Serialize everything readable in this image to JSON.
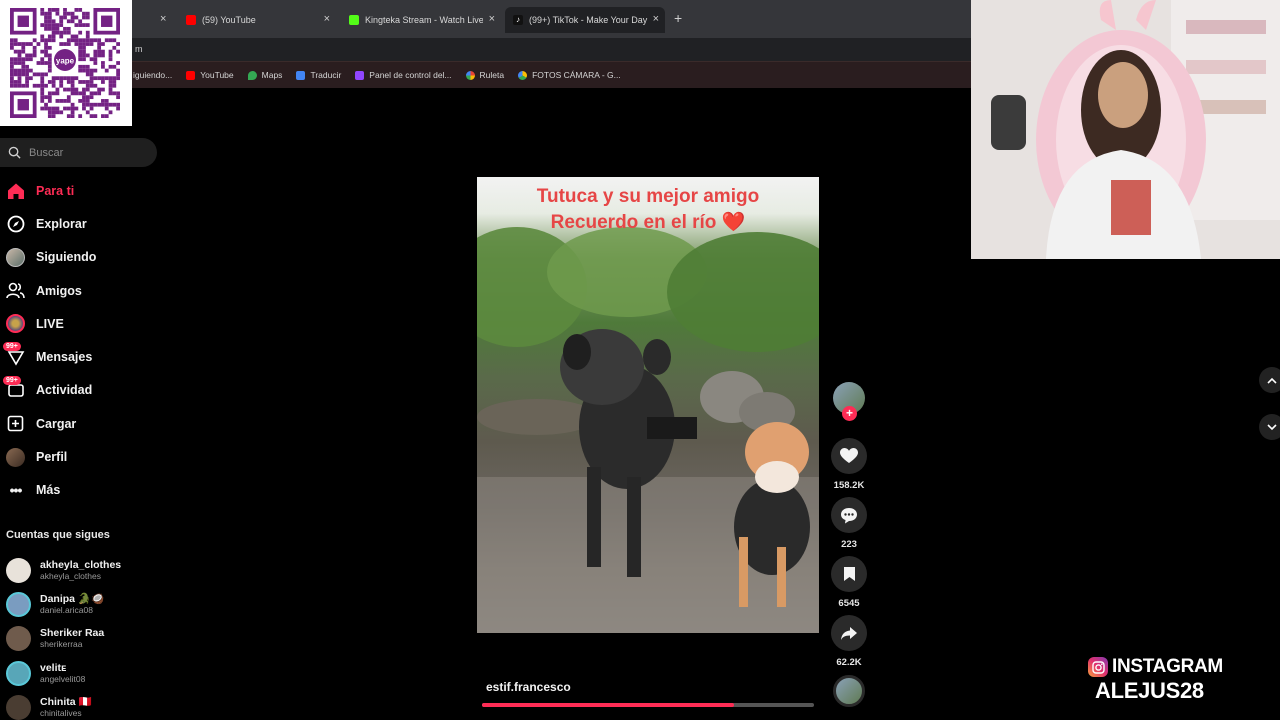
{
  "browser": {
    "tabs": [
      {
        "label": "(59) YouTube",
        "favicon_color": "#ff0000"
      },
      {
        "label": "Kingteka Stream - Watch Live o",
        "favicon_color": "#53fc18"
      },
      {
        "label": "(99+) TikTok - Make Your Day",
        "favicon_color": "#ffffff"
      }
    ],
    "close_glyph": "×",
    "new_tab_glyph": "+",
    "url_fragment": "m",
    "bookmarks": [
      {
        "label": "iguiendo...",
        "color": "#555555"
      },
      {
        "label": "YouTube",
        "color": "#ff0000"
      },
      {
        "label": "Maps",
        "color": "#34a853"
      },
      {
        "label": "Traducir",
        "color": "#4285f4"
      },
      {
        "label": "Panel de control del...",
        "color": "#9146ff"
      },
      {
        "label": "Ruleta",
        "color": "#fbbc05"
      },
      {
        "label": "FOTOS CÁMARA - G...",
        "color": "#4285f4"
      }
    ]
  },
  "qr": {
    "brand_text": "yape",
    "brand_color": "#742284"
  },
  "search": {
    "placeholder": "Buscar"
  },
  "nav": [
    {
      "label": "Para ti",
      "icon": "home-icon",
      "active": true
    },
    {
      "label": "Explorar",
      "icon": "compass-icon"
    },
    {
      "label": "Siguiendo",
      "icon": "avatar-icon"
    },
    {
      "label": "Amigos",
      "icon": "friends-icon"
    },
    {
      "label": "LIVE",
      "icon": "live-icon"
    },
    {
      "label": "Mensajes",
      "icon": "messages-icon",
      "badge": "99+"
    },
    {
      "label": "Actividad",
      "icon": "activity-icon",
      "badge": "99+"
    },
    {
      "label": "Cargar",
      "icon": "upload-icon"
    },
    {
      "label": "Perfil",
      "icon": "profile-icon"
    },
    {
      "label": "Más",
      "icon": "more-icon"
    }
  ],
  "following": {
    "title": "Cuentas que sigues",
    "accounts": [
      {
        "name": "akheyla_clothes",
        "handle": "akheyla_clothes",
        "color": "#e8e2da"
      },
      {
        "name": "Danipa 🐊🥥",
        "handle": "daniel.arica08",
        "color": "#7a9cc0"
      },
      {
        "name": "Sheriker Raa",
        "handle": "sherikerraa",
        "color": "#6f5b4c"
      },
      {
        "name": "velitᴇ",
        "handle": "angelvelit08",
        "color": "#58a6b8"
      },
      {
        "name": "Chinita 🇵🇪",
        "handle": "chinitalives",
        "color": "#4a3d32"
      }
    ]
  },
  "video": {
    "caption_line1": "Tutuca y su mejor amigo",
    "caption_line2": "Recuerdo en el río ❤️",
    "author": "estif.francesco",
    "progress": 0.76
  },
  "actions": {
    "likes": "158.2K",
    "comments": "223",
    "saves": "6545",
    "shares": "62.2K",
    "follow_glyph": "+"
  },
  "overlay": {
    "instagram_label": "INSTAGRAM",
    "instagram_handle": "ALEJUS28"
  },
  "colors": {
    "accent": "#fe2c55",
    "caption": "#e64646"
  }
}
